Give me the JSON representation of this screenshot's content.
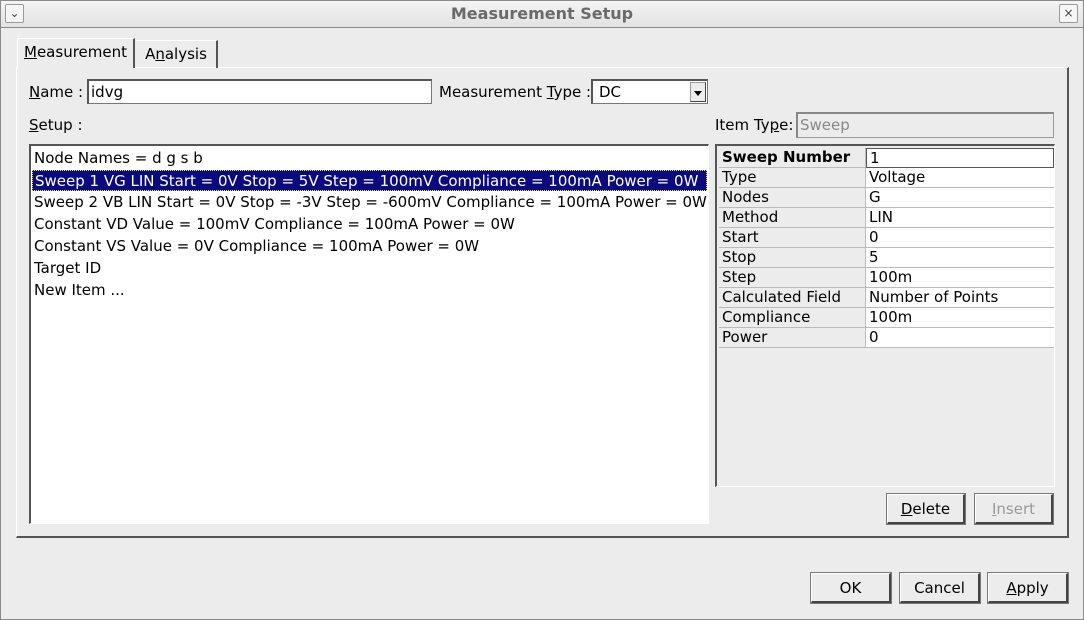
{
  "window": {
    "title": "Measurement Setup",
    "menu_icon": "chevron-down-icon",
    "close_icon": "close-icon"
  },
  "tabs": [
    {
      "label": "Measurement",
      "selected": true
    },
    {
      "label": "Analysis",
      "selected": false
    }
  ],
  "name": {
    "label": "Name :",
    "value": "idvg"
  },
  "measurement_type": {
    "label": "Measurement Type :",
    "value": "DC"
  },
  "setup": {
    "label": "Setup :",
    "items": [
      "Node Names = d g s b",
      "Sweep 1 VG LIN Start = 0V Stop = 5V Step = 100mV Compliance = 100mA Power = 0W",
      "Sweep 2 VB LIN Start = 0V Stop = -3V Step = -600mV Compliance = 100mA Power = 0W",
      "Constant VD Value = 100mV Compliance = 100mA Power = 0W",
      "Constant VS Value = 0V Compliance = 100mA Power = 0W",
      "Target ID",
      "New Item ..."
    ],
    "selected_index": 1
  },
  "item_type": {
    "label": "Item Type:",
    "value": "Sweep"
  },
  "properties": [
    {
      "key": "Sweep Number",
      "value": "1"
    },
    {
      "key": "Type",
      "value": "Voltage"
    },
    {
      "key": "Nodes",
      "value": "G"
    },
    {
      "key": "Method",
      "value": "LIN"
    },
    {
      "key": "Start",
      "value": "0"
    },
    {
      "key": "Stop",
      "value": "5"
    },
    {
      "key": "Step",
      "value": "100m"
    },
    {
      "key": "Calculated Field",
      "value": "Number of Points"
    },
    {
      "key": "Compliance",
      "value": "100m"
    },
    {
      "key": "Power",
      "value": "0"
    }
  ],
  "buttons": {
    "delete": "Delete",
    "insert": "Insert",
    "ok": "OK",
    "cancel": "Cancel",
    "apply": "Apply"
  },
  "colors": {
    "selection": "#0a0a7e",
    "background": "#ececec"
  }
}
